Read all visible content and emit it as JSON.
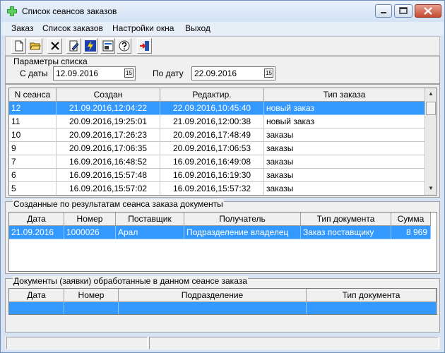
{
  "window": {
    "title": "Список сеансов заказов",
    "app_icon": "green-plus-icon",
    "controls": [
      "minimize-icon",
      "maximize-icon",
      "close-icon"
    ]
  },
  "menu": [
    "Заказ",
    "Список заказов",
    "Настройки окна",
    "Выход"
  ],
  "toolbar": [
    "new-document-icon",
    "open-folder-icon",
    "delete-icon",
    "edit-document-icon",
    "refresh-icon",
    "print-preview-icon",
    "help-icon",
    "exit-icon"
  ],
  "params": {
    "title": "Параметры списка",
    "from_label": "С даты",
    "from_value": "12.09.2016",
    "to_label": "По дату",
    "to_value": "22.09.2016"
  },
  "sessions": {
    "columns": [
      "N сеанса",
      "Создан",
      "Редактир.",
      "Тип заказа"
    ],
    "rows": [
      [
        "12",
        "21.09.2016,12:04:22",
        "22.09.2016,10:45:40",
        "новый заказ"
      ],
      [
        "11",
        "20.09.2016,19:25:01",
        "21.09.2016,12:00:38",
        "новый заказ"
      ],
      [
        "10",
        "20.09.2016,17:26:23",
        "20.09.2016,17:48:49",
        "заказы"
      ],
      [
        "9",
        "20.09.2016,17:06:35",
        "20.09.2016,17:06:53",
        "заказы"
      ],
      [
        "7",
        "16.09.2016,16:48:52",
        "16.09.2016,16:49:08",
        "заказы"
      ],
      [
        "6",
        "16.09.2016,15:57:48",
        "16.09.2016,16:19:30",
        "заказы"
      ],
      [
        "5",
        "16.09.2016,15:57:02",
        "16.09.2016,15:57:32",
        "заказы"
      ]
    ]
  },
  "created_docs": {
    "title": "Созданные по результатам сеанса заказа документы",
    "columns": [
      "Дата",
      "Номер",
      "Поставщик",
      "Получатель",
      "Тип документа",
      "Сумма"
    ],
    "rows": [
      [
        "21.09.2016",
        "1000026",
        "Арал",
        "Подразделение владелец",
        "Заказ поставщику",
        "8 969"
      ]
    ]
  },
  "processed_docs": {
    "title": "Документы (заявки) обработанные в данном сеансе заказа",
    "columns": [
      "Дата",
      "Номер",
      "Подразделение",
      "Тип документа"
    ]
  },
  "colors": {
    "selection": "#3399ff",
    "title_bar": "#d3e2f4",
    "panel": "#f0f0f0"
  }
}
